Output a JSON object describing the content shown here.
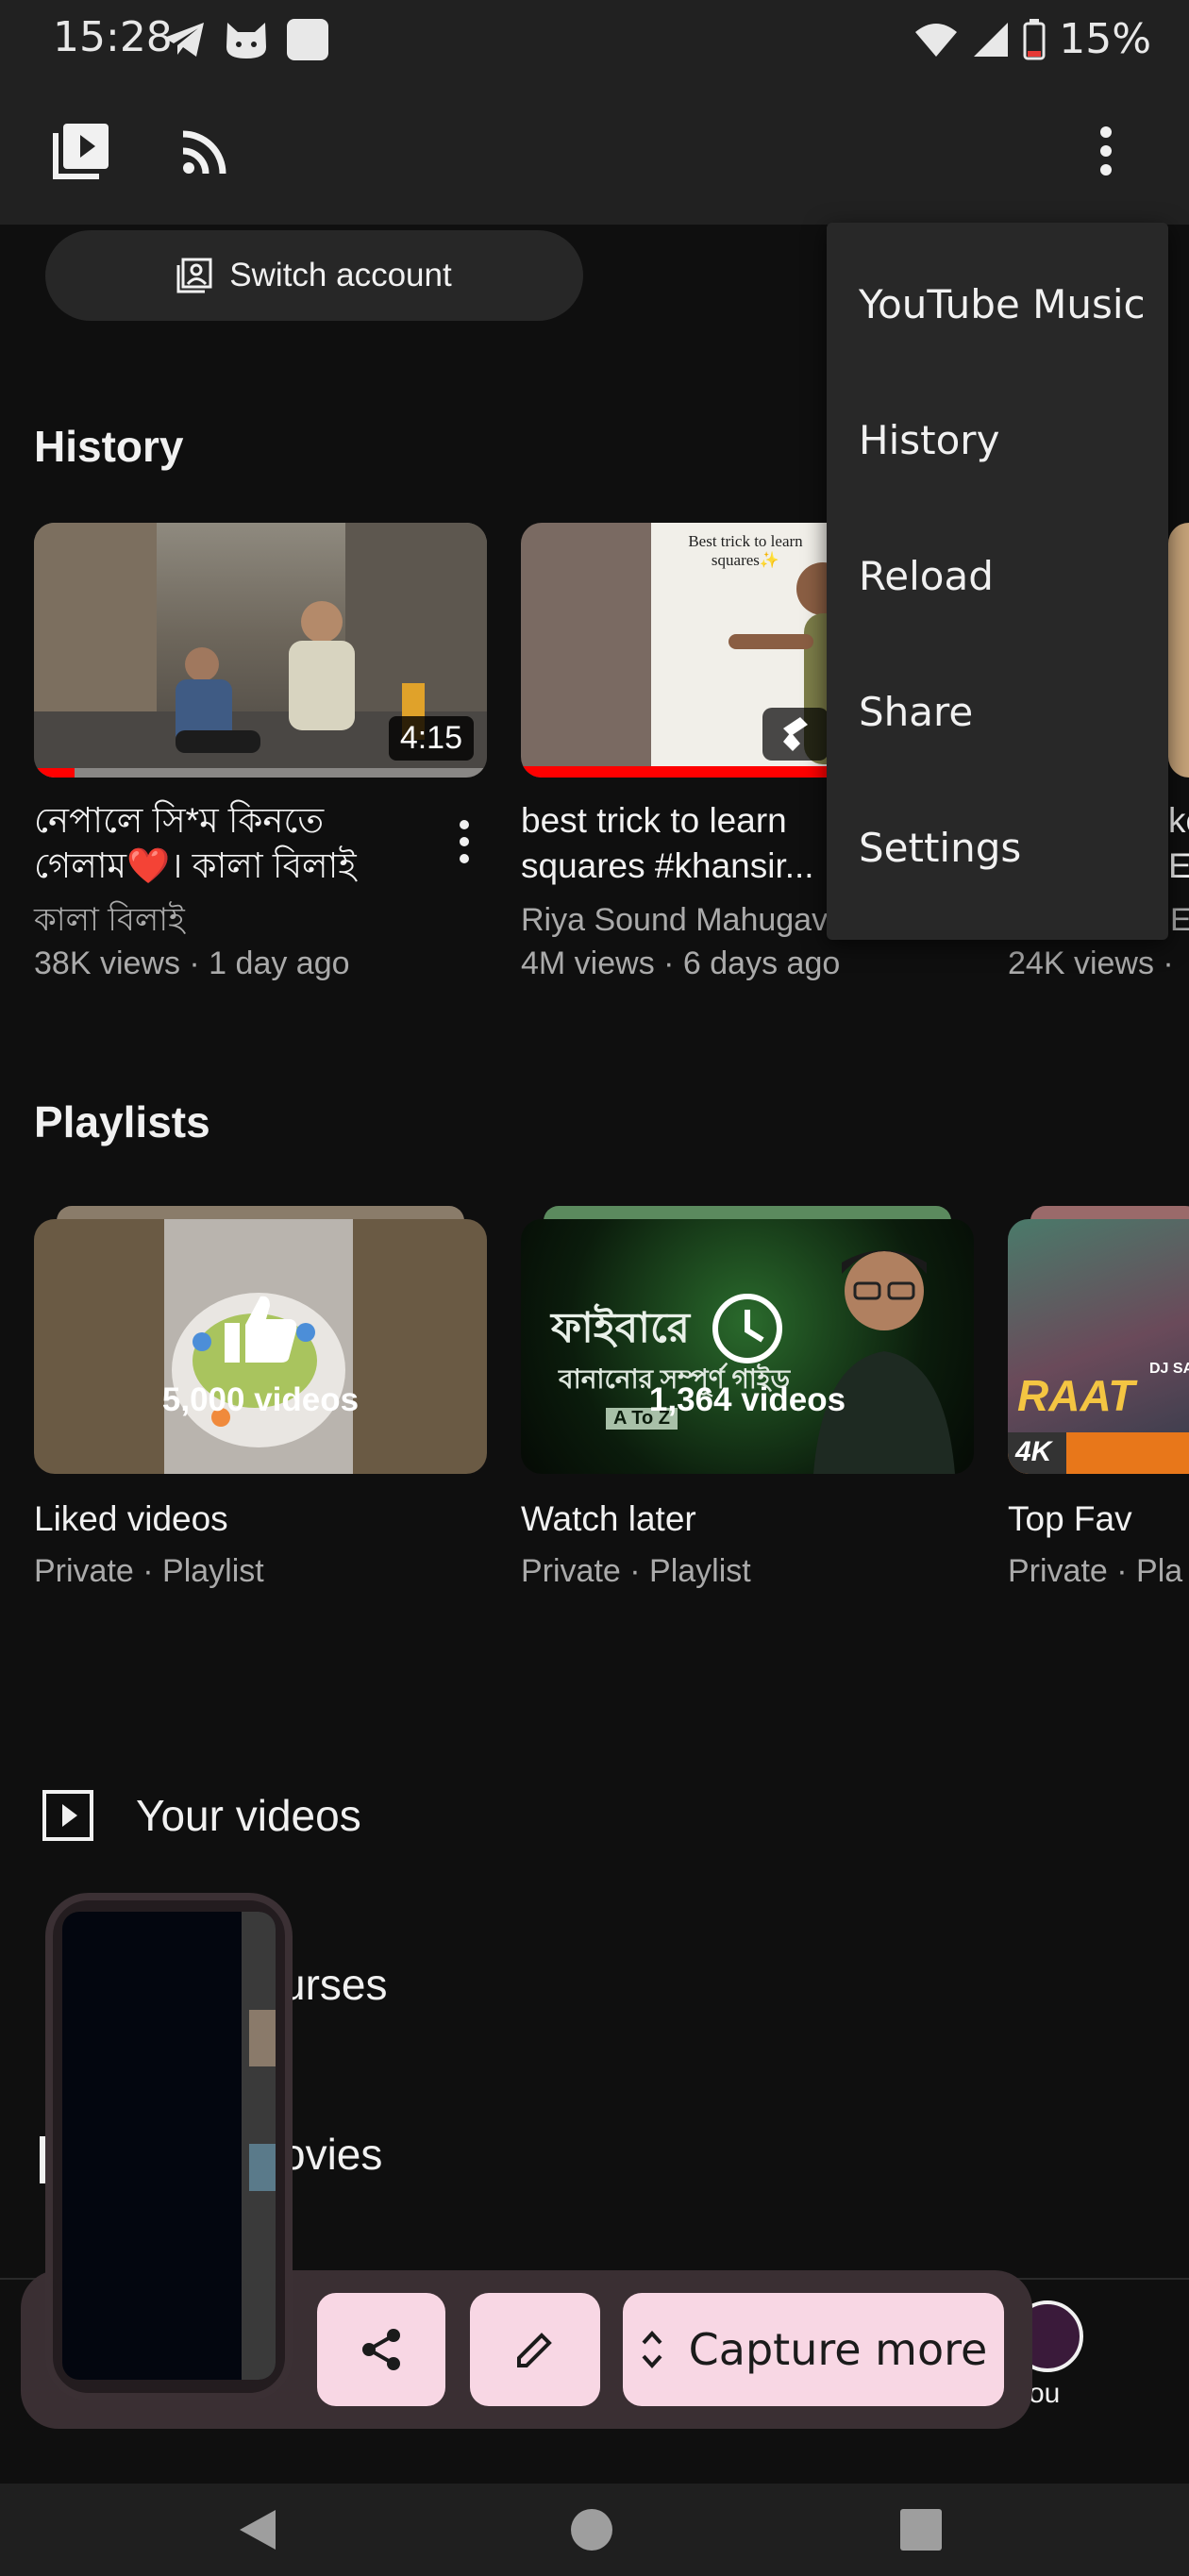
{
  "status_bar": {
    "time": "15:28",
    "battery": "15%"
  },
  "account": {
    "switch_account_label": "Switch account"
  },
  "history": {
    "title": "History",
    "videos": [
      {
        "title_line1": "নেপালে সি*ম কিনতে",
        "title_line2": "গেলাম❤️। কালা বিলাই",
        "channel": "কালা বিলাই",
        "meta": "38K views · 1 day ago",
        "duration": "4:15",
        "progress": 0.09
      },
      {
        "title_line1": "best trick to learn",
        "title_line2": "squares #khansir...",
        "channel": "Riya Sound Mahugav",
        "meta": "4M views · 6 days ago",
        "thumb_text_1": "Best trick to learn",
        "thumb_text_2": "squares✨",
        "progress": 1.0
      },
      {
        "meta": "24K views ·",
        "title_frag_1": "ke",
        "title_frag_2": "ES",
        "channel_frag": "E"
      }
    ]
  },
  "playlists": {
    "title": "Playlists",
    "items": [
      {
        "name": "Liked videos",
        "meta": "Private · Playlist",
        "count": "5,000 videos"
      },
      {
        "name": "Watch later",
        "meta": "Private · Playlist",
        "count": "1,364 videos",
        "thumb_text_1": "ফাইবারে",
        "thumb_text_2": "বানানোর সম্পূর্ণ গাইড",
        "thumb_text_3": "A To Z"
      },
      {
        "name": "Top Fav",
        "meta": "Private · Pla",
        "thumb_text_1": "RAAT",
        "thumb_text_2": "4K",
        "thumb_text_3": "DJ SA"
      }
    ]
  },
  "library_rows": {
    "your_videos": "Your videos",
    "courses_fragment": "urses",
    "movies_fragment": "ovies"
  },
  "menu": {
    "items": [
      "YouTube Music",
      "History",
      "Reload",
      "Share",
      "Settings"
    ]
  },
  "bottom_nav": {
    "you_fragment": "ou"
  },
  "screenshot_toolbar": {
    "capture_more_label": "Capture more"
  },
  "colors": {
    "accent_red": "#ff0000",
    "toolbar_button": "#f8d7e4",
    "background": "#0f0f0f",
    "surface": "#212121"
  }
}
